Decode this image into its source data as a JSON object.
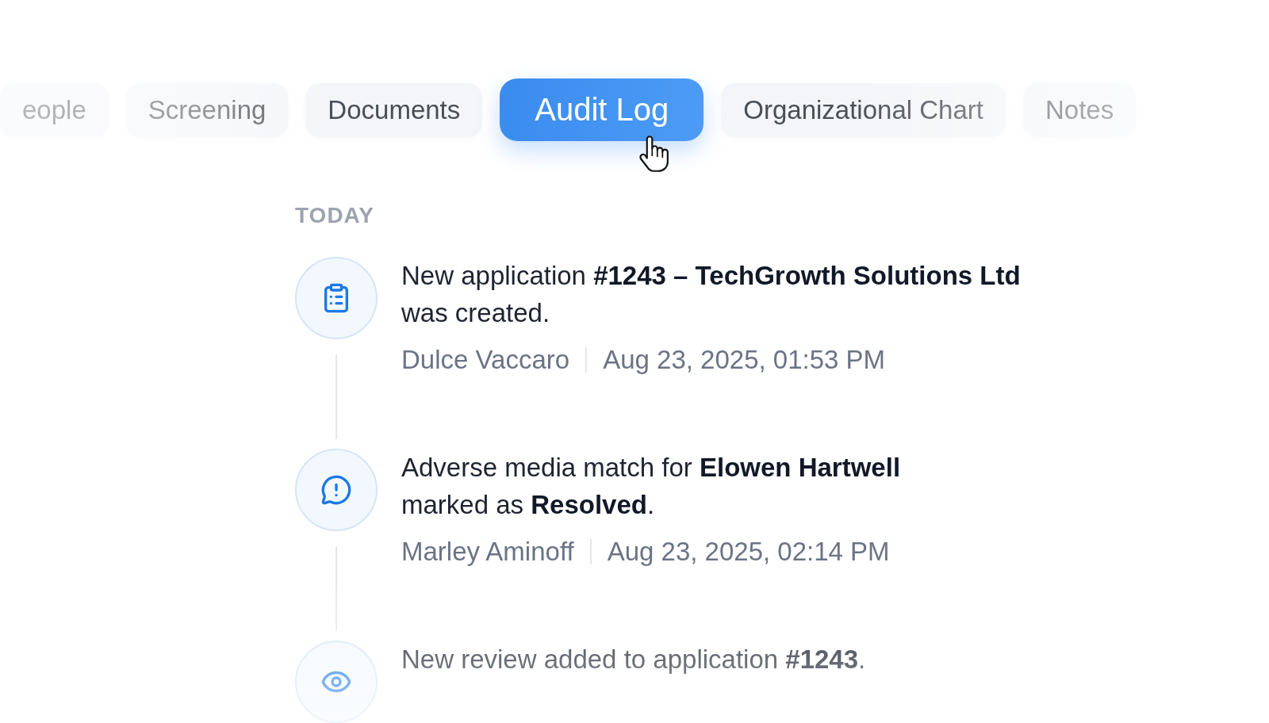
{
  "tabs": [
    {
      "label": "eople",
      "selected": false
    },
    {
      "label": "Screening",
      "selected": false
    },
    {
      "label": "Documents",
      "selected": false
    },
    {
      "label": "Audit Log",
      "selected": true
    },
    {
      "label": "Organizational Chart",
      "selected": false
    },
    {
      "label": "Notes",
      "selected": false
    }
  ],
  "audit_log": {
    "group_label": "TODAY",
    "entries": [
      {
        "kind": "created",
        "message": "New application **#1243 – TechGrowth Solutions Ltd**\nwas created.",
        "author": "Dulce Vaccaro",
        "timestamp": "Aug 23, 2025, 01:53 PM"
      },
      {
        "kind": "flagged",
        "message": "Adverse media match for **Elowen Hartwell**\nmarked as **Resolved**.",
        "author": "Marley Aminoff",
        "timestamp": "Aug 23, 2025, 02:14 PM"
      },
      {
        "kind": "reviewed",
        "message": "New review added to application **#1243**."
      }
    ]
  }
}
